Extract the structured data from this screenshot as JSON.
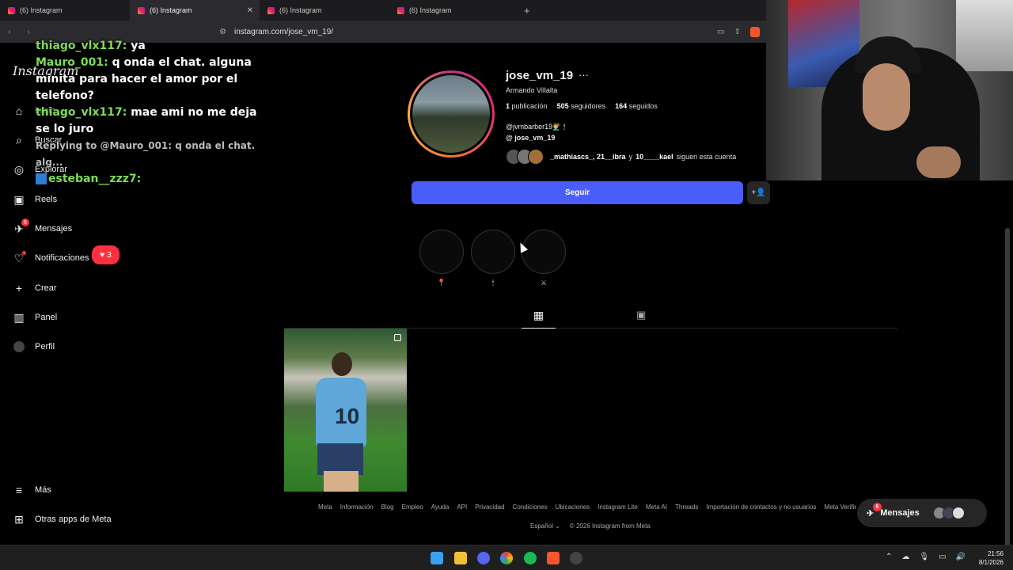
{
  "browser": {
    "tabs": [
      {
        "label": "(6) Instagram",
        "active": false
      },
      {
        "label": "(6) Instagram",
        "active": true
      },
      {
        "label": "(6) Instagram",
        "active": false
      },
      {
        "label": "(6) Instagram",
        "active": false
      }
    ],
    "new_tab": "+",
    "url": "instagram.com/jose_vm_19/"
  },
  "sidebar": {
    "logo": "Instagram",
    "items": [
      {
        "label": "Inicio",
        "icon": "home-icon"
      },
      {
        "label": "Buscar",
        "icon": "search-icon"
      },
      {
        "label": "Explorar",
        "icon": "compass-icon"
      },
      {
        "label": "Reels",
        "icon": "reels-icon"
      },
      {
        "label": "Mensajes",
        "icon": "messenger-icon",
        "badge": "6"
      },
      {
        "label": "Notificaciones",
        "icon": "heart-icon",
        "pill": "3"
      },
      {
        "label": "Crear",
        "icon": "plus-icon"
      },
      {
        "label": "Panel",
        "icon": "chart-icon"
      },
      {
        "label": "Perfil",
        "icon": "avatar-icon"
      }
    ],
    "bottom": [
      {
        "label": "Más",
        "icon": "menu-icon"
      },
      {
        "label": "Otras apps de Meta",
        "icon": "meta-apps-icon"
      }
    ]
  },
  "chat_overlay": {
    "lines": [
      {
        "user": "thiago_vlx117:",
        "text": "ya"
      },
      {
        "user": "Mauro_001:",
        "text": "q onda el chat. alguna minita para hacer el amor por el telefono?"
      },
      {
        "user": "thiago_vlx117:",
        "text": "mae ami no me deja se lo juro"
      }
    ],
    "reply": "Replying to @Mauro_001: q onda el chat. alg...",
    "last_user": "esteban__zzz7:"
  },
  "profile": {
    "username": "jose_vm_19",
    "more": "···",
    "full_name": "Armando Villalta",
    "posts_count": "1",
    "posts_label": "publicación",
    "followers_count": "505",
    "followers_label": "seguidores",
    "following_count": "164",
    "following_label": "seguidos",
    "bio": "@jvmbarber19💇‍♂️ 🕯",
    "threads_handle": "jose_vm_19",
    "followed_by_prefix": "_mathiascs_, 21__ibra",
    "followed_by_middle": "y",
    "followed_by_last": "10____kael",
    "followed_by_suffix": "siguen esta cuenta",
    "follow_label": "Seguir",
    "suggest_icon": "add-person-icon"
  },
  "highlights": [
    {
      "label": "📍"
    },
    {
      "label": "🕯"
    },
    {
      "label": "⚔"
    }
  ],
  "footer": {
    "links": [
      "Meta",
      "Información",
      "Blog",
      "Empleo",
      "Ayuda",
      "API",
      "Privacidad",
      "Condiciones",
      "Ubicaciones",
      "Instagram Lite",
      "Meta AI",
      "Threads",
      "Importación de contactos y no usuarios",
      "Meta Verified"
    ],
    "language": "Español",
    "copyright": "© 2026 Instagram from Meta"
  },
  "messages_pill": {
    "label": "Mensajes",
    "badge": "6"
  },
  "post": {
    "jersey_number": "10"
  },
  "taskbar": {
    "time": "21:56",
    "date": "8/1/2026"
  },
  "colors": {
    "follow_button": "#4a5df9",
    "notification_red": "#ff3040",
    "chat_username": "#7ddc54"
  }
}
